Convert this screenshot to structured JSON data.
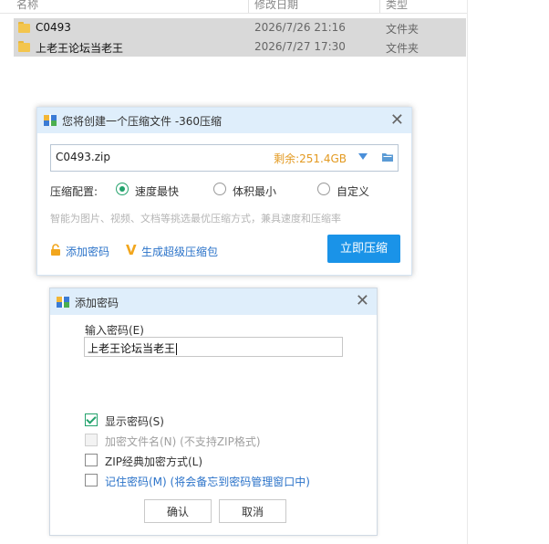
{
  "explorer": {
    "columns": [
      "名称",
      "修改日期",
      "类型"
    ],
    "rows": [
      {
        "name": "C0493",
        "date": "2026/7/26 21:16",
        "type": "文件夹"
      },
      {
        "name": "上老王论坛当老王",
        "date": "2026/7/27 17:30",
        "type": "文件夹"
      }
    ]
  },
  "zip_dialog": {
    "title": "您将创建一个压缩文件 -360压缩",
    "close": "✕",
    "filename": "C0493.zip",
    "free_space": "剩余:251.4GB",
    "config_label": "压缩配置:",
    "options": [
      {
        "label": "速度最快",
        "selected": true
      },
      {
        "label": "体积最小",
        "selected": false
      },
      {
        "label": "自定义",
        "selected": false
      }
    ],
    "hint": "智能为图片、视频、文档等挑选最优压缩方式，兼具速度和压缩率",
    "add_password": "添加密码",
    "super_pack": "生成超级压缩包",
    "compress_button": "立即压缩"
  },
  "password_dialog": {
    "title": "添加密码",
    "close": "✕",
    "input_label": "输入密码(E)",
    "password_value": "上老王论坛当老王",
    "checkboxes": [
      {
        "label": "显示密码(S)",
        "checked": true,
        "disabled": false
      },
      {
        "label": "加密文件名(N) (不支持ZIP格式)",
        "checked": false,
        "disabled": true
      },
      {
        "label": "ZIP经典加密方式(L)",
        "checked": false,
        "disabled": false
      },
      {
        "label": "记住密码(M) (将会备忘到密码管理窗口中)",
        "checked": false,
        "disabled": false
      }
    ],
    "ok_button": "确认",
    "cancel_button": "取消"
  },
  "colors": {
    "accent": "#1a93e8",
    "title_bar": "#dfeefb",
    "selected_row": "#d9d9d9",
    "space_text": "#e39a21",
    "link": "#2b73c9",
    "check_green": "#23a26c"
  }
}
